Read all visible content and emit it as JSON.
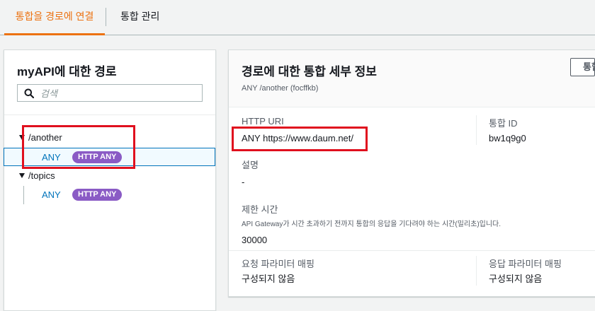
{
  "tabs": [
    {
      "label": "통합을 경로에 연결",
      "active": true
    },
    {
      "label": "통합 관리",
      "active": false
    }
  ],
  "left_panel": {
    "title": "myAPI에 대한 경로",
    "search_placeholder": "검색",
    "routes": [
      {
        "path": "/another",
        "methods": [
          {
            "method": "ANY",
            "badge": "HTTP ANY",
            "selected": true
          }
        ]
      },
      {
        "path": "/topics",
        "methods": [
          {
            "method": "ANY",
            "badge": "HTTP ANY",
            "selected": false
          }
        ]
      }
    ]
  },
  "detail": {
    "title": "경로에 대한 통합 세부 정보",
    "subtitle": "ANY /another (focffkb)",
    "header_button_label": "통합",
    "http_uri_label": "HTTP URI",
    "http_uri_value": "ANY https://www.daum.net/",
    "integration_id_label": "통합 ID",
    "integration_id_value": "bw1q9g0",
    "description_label": "설명",
    "description_value": "-",
    "timeout_label": "제한 시간",
    "timeout_desc": "API Gateway가 시간 초과하기 전까지 통합의 응답을 기다려야 하는 시간(밀리초)입니다.",
    "timeout_value": "30000",
    "request_mapping_label": "요청 파라미터 매핑",
    "request_mapping_value": "구성되지 않음",
    "response_mapping_label": "응답 파라미터 매핑",
    "response_mapping_value": "구성되지 않음"
  },
  "colors": {
    "accent": "#ec7211",
    "link": "#0073bb",
    "badge": "#8a5bc5",
    "highlight": "#e0101e"
  }
}
